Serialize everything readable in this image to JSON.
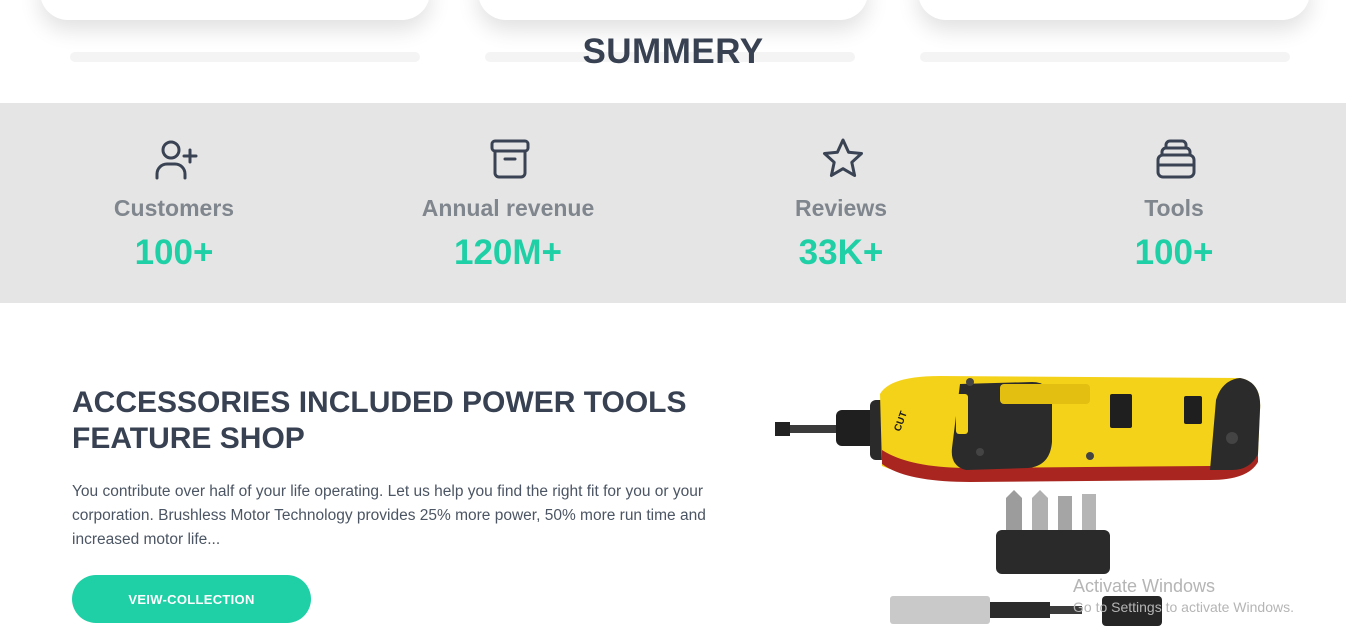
{
  "summary": {
    "title": "SUMMERY"
  },
  "stats": [
    {
      "icon": "user-plus-icon",
      "label": "Customers",
      "value": "100+"
    },
    {
      "icon": "archive-box-icon",
      "label": "Annual revenue",
      "value": "120M+"
    },
    {
      "icon": "star-icon",
      "label": "Reviews",
      "value": "33K+"
    },
    {
      "icon": "stack-icon",
      "label": "Tools",
      "value": "100+"
    }
  ],
  "feature": {
    "heading": "ACCESSORIES INCLUDED POWER TOOLS FEATURE SHOP",
    "text": "You contribute over half of your life operating. Let us help you find the right fit for you or your corporation. Brushless Motor Technology provides 25% more power, 50% more run time and increased motor life...",
    "button_label": "VEIW-COLLECTION",
    "image_lettering": "CUT"
  },
  "watermark": {
    "line1": "Activate Windows",
    "line2": "Go to Settings to activate Windows."
  },
  "colors": {
    "accent": "#1fd0a6",
    "heading": "#374151",
    "band": "#e5e5e5",
    "muted": "#80868d",
    "tool_yellow": "#f5d21a"
  }
}
